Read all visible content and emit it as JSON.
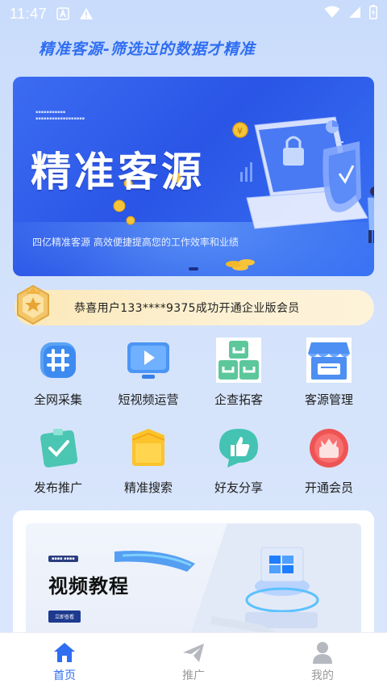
{
  "status_bar": {
    "time": "11:47",
    "icons": [
      "font-icon",
      "warning-icon",
      "wifi-icon",
      "signal-icon",
      "battery-icon"
    ]
  },
  "slogan": "精准客源-筛选过的数据才精准",
  "banner": {
    "title": "精准客源",
    "subtitle": "四亿精准客源 高效便捷提高您的工作效率和业绩"
  },
  "notice": {
    "text": "恭喜用户133****9375成功开通企业版会员"
  },
  "grid": [
    {
      "label": "全网采集",
      "icon": "hash-grid-icon"
    },
    {
      "label": "短视频运营",
      "icon": "video-play-icon"
    },
    {
      "label": "企查拓客",
      "icon": "building-blocks-icon"
    },
    {
      "label": "客源管理",
      "icon": "store-icon"
    },
    {
      "label": "发布推广",
      "icon": "publish-check-icon"
    },
    {
      "label": "精准搜索",
      "icon": "folder-search-icon"
    },
    {
      "label": "好友分享",
      "icon": "thumbs-up-icon"
    },
    {
      "label": "开通会员",
      "icon": "vip-gift-icon"
    }
  ],
  "video_card": {
    "title": "视频教程",
    "watch_label": "立即查看"
  },
  "bottom_nav": [
    {
      "label": "首页",
      "icon": "home-icon",
      "active": true
    },
    {
      "label": "推广",
      "icon": "paper-plane-icon",
      "active": false
    },
    {
      "label": "我的",
      "icon": "person-icon",
      "active": false
    }
  ],
  "colors": {
    "accent": "#2f6df2",
    "banner_blue": "#3463ee",
    "notice_gold": "#fbe8b9",
    "inactive": "#999999"
  }
}
